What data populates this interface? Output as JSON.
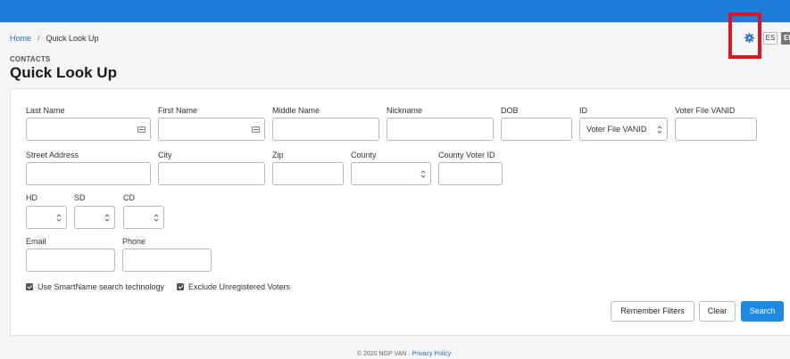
{
  "breadcrumb": {
    "home": "Home",
    "separator": "/",
    "current": "Quick Look Up"
  },
  "header": {
    "section": "CONTACTS",
    "title": "Quick Look Up",
    "lang_es": "ES",
    "lang_en": "EN"
  },
  "form": {
    "last_name": "Last Name",
    "first_name": "First Name",
    "middle_name": "Middle Name",
    "nickname": "Nickname",
    "dob": "DOB",
    "id": "ID",
    "id_selected": "Voter File VANID",
    "voter_file_vanid": "Voter File VANID",
    "street_address": "Street Address",
    "city": "City",
    "zip": "Zip",
    "county": "County",
    "county_voter_id": "County Voter ID",
    "hd": "HD",
    "sd": "SD",
    "cd": "CD",
    "email": "Email",
    "phone": "Phone",
    "smartname": "Use SmartName search technology",
    "exclude_unregistered": "Exclude Unregistered Voters"
  },
  "buttons": {
    "remember": "Remember Filters",
    "clear": "Clear",
    "search": "Search"
  },
  "footer": {
    "copyright": "© 2020 NGP VAN · ",
    "privacy": "Privacy Policy"
  },
  "colors": {
    "topbar": "#1e7bd8",
    "primary": "#1e88e5",
    "highlight": "#e0141e"
  }
}
